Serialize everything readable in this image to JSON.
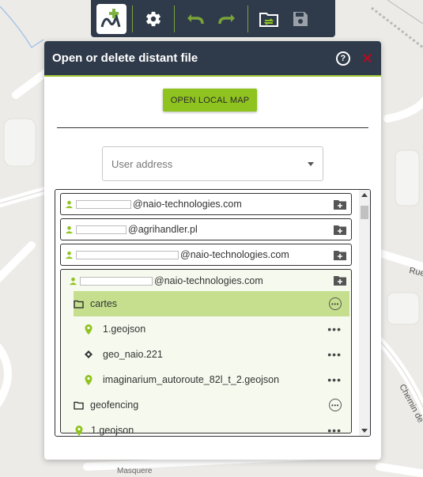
{
  "toolbar": {
    "buttons": [
      {
        "name": "app-logo",
        "icon": "naio-logo"
      },
      {
        "name": "settings",
        "icon": "gear-icon"
      },
      {
        "name": "undo",
        "icon": "undo-icon"
      },
      {
        "name": "redo",
        "icon": "redo-icon"
      },
      {
        "name": "open-distant",
        "icon": "folder-sync-icon"
      },
      {
        "name": "save",
        "icon": "floppy-icon"
      }
    ]
  },
  "map": {
    "street_labels": [
      "Rue",
      "Chemin de",
      "Masquere"
    ]
  },
  "dialog": {
    "title": "Open or delete distant file",
    "help_label": "?",
    "close_label": "✕",
    "open_local_label": "OPEN LOCAL MAP",
    "select_placeholder": "User address"
  },
  "users": [
    {
      "domain": "@naio-technologies.com"
    },
    {
      "domain": "@agrihandler.pl"
    },
    {
      "domain": "@naio-technologies.com"
    },
    {
      "domain": "@naio-technologies.com",
      "expanded": true
    }
  ],
  "tree": [
    {
      "type": "folder",
      "label": "cartes",
      "selected": true,
      "icon": "folder-icon"
    },
    {
      "type": "file",
      "label": "1.geojson",
      "icon": "map-pin-icon"
    },
    {
      "type": "file",
      "label": "geo_naio.221",
      "icon": "diamond-icon"
    },
    {
      "type": "file",
      "label": "imaginarium_autoroute_82l_t_2.geojson",
      "icon": "map-pin-icon"
    },
    {
      "type": "folder",
      "label": "geofencing",
      "icon": "folder-icon"
    },
    {
      "type": "file",
      "label": "1.geojson",
      "icon": "map-pin-icon"
    }
  ],
  "colors": {
    "accent": "#8fc31f",
    "header": "#2f3b4a",
    "close": "#d0021b"
  }
}
